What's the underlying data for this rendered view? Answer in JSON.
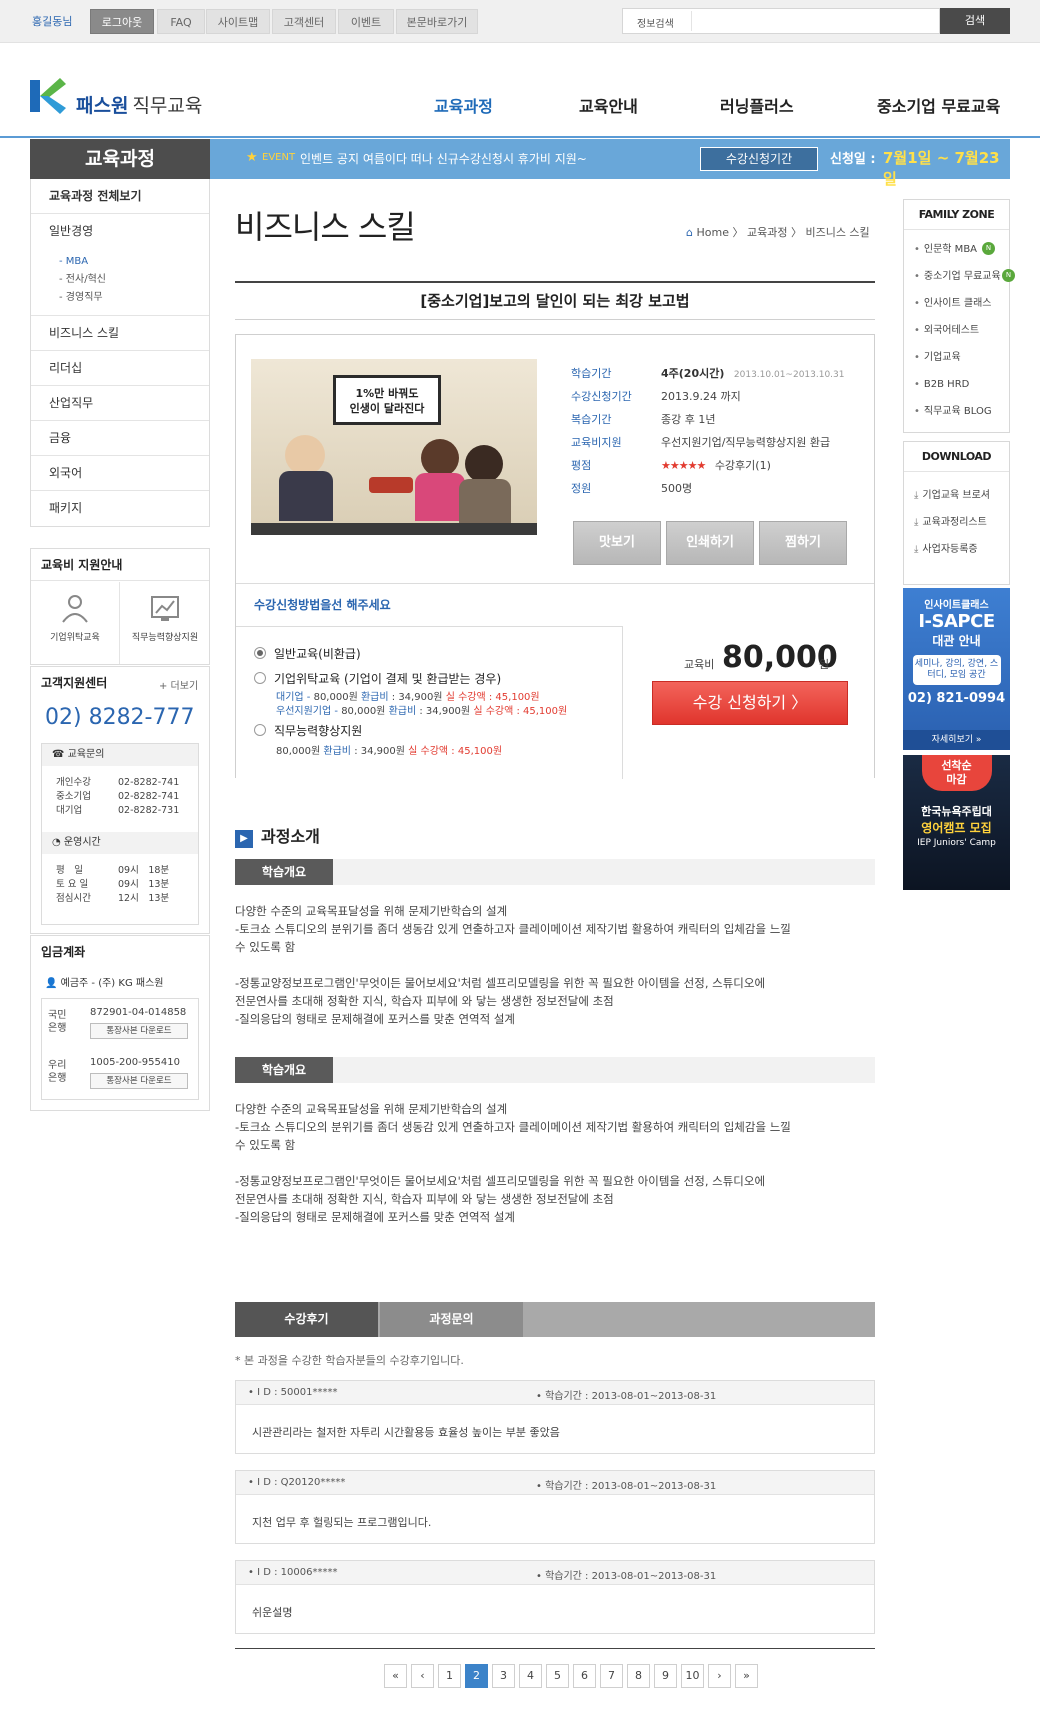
{
  "topbar": {
    "user": "홍길동님",
    "buttons": [
      "로그아웃",
      "FAQ",
      "사이트맵",
      "고객센터",
      "이벤트",
      "본문바로가기"
    ],
    "search_label": "정보검색",
    "search_value": "",
    "search_button": "검색"
  },
  "header": {
    "logo_brand": "패스원",
    "logo_sub": "직무교육",
    "nav": [
      "교육과정",
      "교육안내",
      "러닝플러스",
      "중소기업 무료교육"
    ]
  },
  "banner": {
    "section_title": "교육과정",
    "event_tag": "EVENT",
    "event_text": "인벤트 공지 여름이다 떠나 신규수강신청시 휴가비 지원~",
    "period_label": "수강신청기간",
    "date_label": "신청일 :",
    "date_value": "7월1일 ~ 7월23일"
  },
  "lnb": {
    "items_top": [
      "교육과정 전체보기",
      "일반경영"
    ],
    "sub_items": [
      "MBA",
      "전사/혁신",
      "경영직무"
    ],
    "items_bottom": [
      "비즈니스 스킬",
      "리더십",
      "산업직무",
      "금융",
      "외국어",
      "패키지"
    ]
  },
  "support": {
    "title": "교육비 지원안내",
    "cards": [
      "기업위탁교육",
      "직무능력향상지원"
    ]
  },
  "cs": {
    "title": "고객지원센터",
    "more": "+ 더보기",
    "phone": "02) 8282-777",
    "inquiry_title": "교육문의",
    "inquiry_rows": [
      [
        "개인수강",
        "02-8282-741"
      ],
      [
        "중소기업",
        "02-8282-741"
      ],
      [
        "대기업",
        "02-8282-731"
      ]
    ],
    "hours_title": "운영시간",
    "hours_rows": [
      [
        "평　일",
        "09시　18분"
      ],
      [
        "토 요 일",
        "09시　13분"
      ],
      [
        "점심시간",
        "12시　13분"
      ]
    ]
  },
  "account": {
    "title": "입금계좌",
    "holder": "예금주 - (주) KG 패스원",
    "banks": [
      {
        "bank": "국민\n은행",
        "number": "872901-04-014858",
        "button": "통장사본 다운로드"
      },
      {
        "bank": "우리\n은행",
        "number": "1005-200-955410",
        "button": "통장사본 다운로드"
      }
    ]
  },
  "right": {
    "family_title": "FAMILY ZONE",
    "family_items": [
      "인문학 MBA",
      "중소기업 무료교육",
      "인사이트 클래스",
      "외국어테스트",
      "기업교육",
      "B2B HRD",
      "직무교육 BLOG"
    ],
    "download_title": "DOWNLOAD",
    "download_items": [
      "기업교육 브로셔",
      "교육과정리스트",
      "사업자등록증"
    ],
    "ad1_title": "인사이트클래스",
    "ad1_brand": "I-SAPCE",
    "ad1_sub": "대관 안내",
    "ad1_desc": "세미나, 강의, 강연, 스터디, 모임 공간",
    "ad1_phone": "02) 821-0994",
    "ad1_more": "자세히보기 »",
    "ad2_badge": "선착순\n마감",
    "ad2_title": "한국뉴욕주립대",
    "ad2_title2": "영어캠프 모집",
    "ad2_sub": "IEP Juniors' Camp"
  },
  "page": {
    "title": "비즈니스 스킬",
    "breadcrumb": [
      "Home",
      "교육과정",
      "비즈니스 스킬"
    ]
  },
  "course": {
    "title": "[중소기업]보고의 달인이 되는 최강 보고법",
    "thumb_text": "1%만 바꿔도\n인생이 달라진다",
    "info": [
      {
        "k": "학습기간",
        "v": "4주(20시간)",
        "extra": "2013.10.01~2013.10.31"
      },
      {
        "k": "수강신청기간",
        "v": "2013.9.24 까지",
        "extra": ""
      },
      {
        "k": "복습기간",
        "v": "종강 후 1년",
        "extra": ""
      },
      {
        "k": "교육비지원",
        "v": "우선지원기업/직무능력향상지원 환급",
        "extra": ""
      },
      {
        "k": "평점",
        "v": "★★★★★",
        "extra": "수강후기(1)"
      },
      {
        "k": "정원",
        "v": "500명",
        "extra": ""
      }
    ],
    "actions": [
      "맛보기",
      "인쇄하기",
      "찜하기"
    ],
    "apply_title": "수강신청방법을선 해주세요",
    "options": [
      {
        "label": "일반교육(비환급)"
      },
      {
        "label": "기업위탁교육 (기업이 결제 및 환급받는 경우)"
      },
      {
        "label": "직무능력향상지원"
      }
    ],
    "opt2_rows": [
      {
        "who": "대기업 -",
        "price": "80,000원",
        "refund_l": "환급비",
        "refund": ": 34,900원",
        "real_l": "실 수강액",
        "real": ": 45,100원"
      },
      {
        "who": "우선지원기업 -",
        "price": "80,000원",
        "refund_l": "환급비",
        "refund": ": 34,900원",
        "real_l": "실 수강액",
        "real": ": 45,100원"
      }
    ],
    "opt3_row": {
      "price": "80,000원",
      "refund_l": "환급비",
      "refund": ": 34,900원",
      "real_l": "실 수강액",
      "real": ": 45,100원"
    },
    "fee_label": "교육비",
    "fee": "80,000",
    "fee_unit": "원",
    "apply_button": "수강 신청하기 〉"
  },
  "intro": {
    "title": "과정소개",
    "blocks": [
      {
        "tab": "학습개요",
        "text": "다양한 수준의 교육목표달성을 위해 문제기반학습의 설계\n-토크쇼 스튜디오의 분위기를 좀더 생동감 있게 연출하고자 클레이메이션 제작기법 활용하여 캐릭터의 입체감을 느낄\n수 있도록 함\n\n-정통교양정보프로그램인'무엇이든 물어보세요'처럼 셀프리모델링을 위한 꼭 필요한 아이템을 선정, 스튜디오에\n 전문연사를 초대해 정확한 지식, 학습자 피부에 와 닿는 생생한 정보전달에 초점\n-질의응답의 형태로 문제해결에 포커스를 맞춘 연역적 설계"
      },
      {
        "tab": "학습개요",
        "text": "다양한 수준의 교육목표달성을 위해 문제기반학습의 설계\n-토크쇼 스튜디오의 분위기를 좀더 생동감 있게 연출하고자 클레이메이션 제작기법 활용하여 캐릭터의 입체감을 느낄\n수 있도록 함\n\n-정통교양정보프로그램인'무엇이든 물어보세요'처럼 셀프리모델링을 위한 꼭 필요한 아이템을 선정, 스튜디오에\n 전문연사를 초대해 정확한 지식, 학습자 피부에 와 닿는 생생한 정보전달에 초점\n-질의응답의 형태로 문제해결에 포커스를 맞춘 연역적 설계"
      }
    ]
  },
  "reviews": {
    "tabs": [
      "수강후기",
      "과정문의"
    ],
    "note": "* 본 과정을 수강한 학습자분들의 수강후기입니다.",
    "items": [
      {
        "id": "• I D : 50001*****",
        "period": "• 학습기간 : 2013-08-01~2013-08-31",
        "text": "시관관리라는 철저한 자투리 시간활용등 효율성 높이는 부분 좋았음"
      },
      {
        "id": "• I D : Q20120*****",
        "period": "• 학습기간 : 2013-08-01~2013-08-31",
        "text": "지천 업무 후 헐링되는 프로그램입니다."
      },
      {
        "id": "• I D : 10006*****",
        "period": "• 학습기간 : 2013-08-01~2013-08-31",
        "text": "쉬운설명"
      }
    ]
  },
  "pager": {
    "first": "«",
    "prev": "‹",
    "next": "›",
    "last": "»",
    "pages": [
      "1",
      "2",
      "3",
      "4",
      "5",
      "6",
      "7",
      "8",
      "9",
      "10"
    ],
    "current": "2"
  },
  "colors": {
    "accent": "#2b66b0",
    "event_bg": "#69a7d9",
    "apply": "#e0352d"
  }
}
